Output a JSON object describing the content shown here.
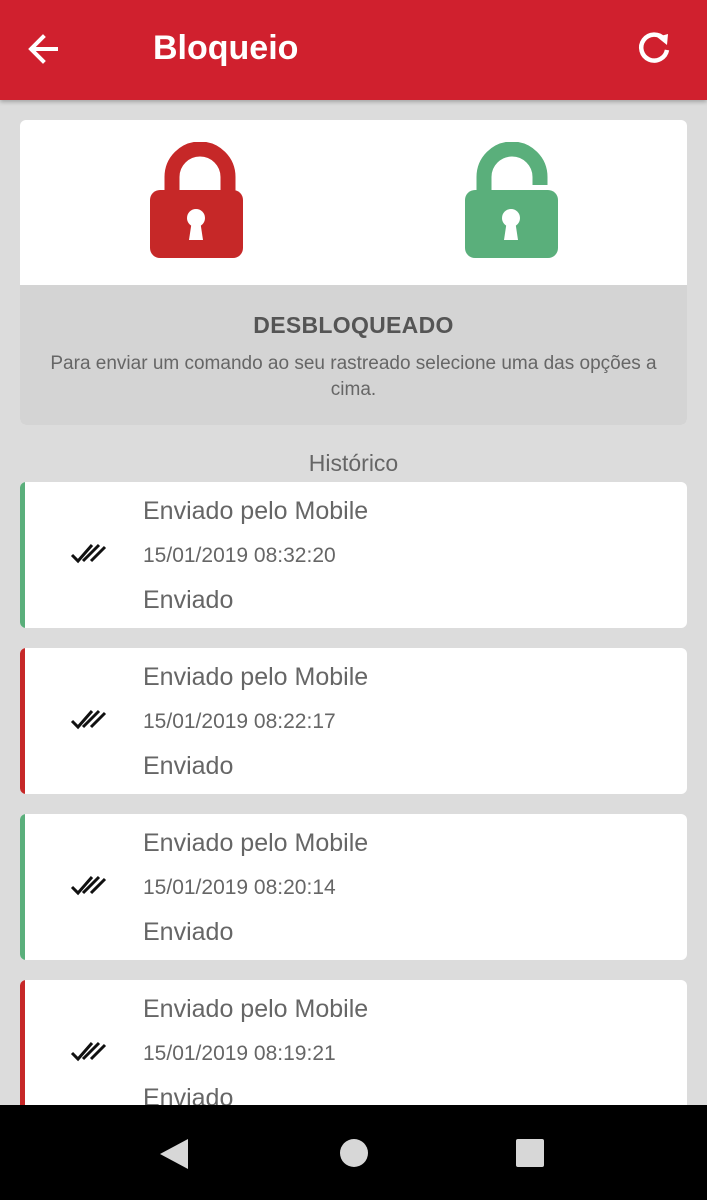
{
  "header": {
    "title": "Bloqueio",
    "back_icon": "arrow-left-icon",
    "refresh_icon": "refresh-icon",
    "background_color": "#d0202e"
  },
  "lock_panel": {
    "lock_icon": "lock-closed-icon",
    "lock_color": "#c62828",
    "unlock_icon": "lock-open-icon",
    "unlock_color": "#5aaf7b",
    "status_title": "DESBLOQUEADO",
    "status_description": "Para enviar um comando ao seu rastreado selecione uma das opções a cima."
  },
  "history": {
    "title": "Histórico",
    "items": [
      {
        "source": "Enviado pelo Mobile",
        "datetime": "15/01/2019 08:32:20",
        "status": "Enviado",
        "accent_color": "#5aaf7b",
        "icon": "double-check-icon"
      },
      {
        "source": "Enviado pelo Mobile",
        "datetime": "15/01/2019 08:22:17",
        "status": "Enviado",
        "accent_color": "#c62828",
        "icon": "double-check-icon"
      },
      {
        "source": "Enviado pelo Mobile",
        "datetime": "15/01/2019 08:20:14",
        "status": "Enviado",
        "accent_color": "#5aaf7b",
        "icon": "double-check-icon"
      },
      {
        "source": "Enviado pelo Mobile",
        "datetime": "15/01/2019 08:19:21",
        "status": "Enviado",
        "accent_color": "#c62828",
        "icon": "double-check-icon"
      }
    ]
  },
  "system_nav": {
    "back_icon": "nav-back-triangle-icon",
    "home_icon": "nav-home-circle-icon",
    "recents_icon": "nav-recents-square-icon"
  }
}
